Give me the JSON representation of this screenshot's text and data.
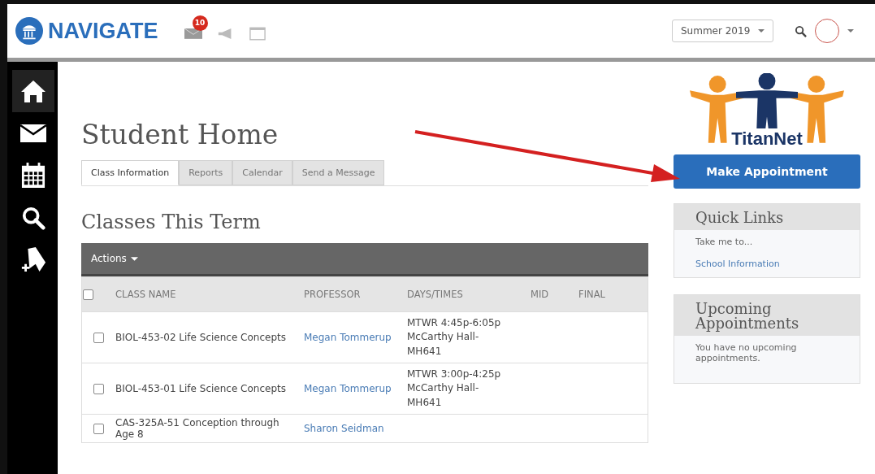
{
  "header": {
    "logo": "NAVIGATE",
    "message_badge": "10",
    "term_select": {
      "value": "Summer 2019"
    }
  },
  "sidebar": [
    {
      "kind": "home",
      "selected": true
    },
    {
      "kind": "mail",
      "selected": false
    },
    {
      "kind": "calendar",
      "selected": false
    },
    {
      "kind": "search",
      "selected": false
    },
    {
      "kind": "bookmark",
      "selected": false
    }
  ],
  "page_title": "Student Home",
  "tabs": [
    {
      "label": "Class Information",
      "selected": true
    },
    {
      "label": "Reports",
      "selected": false
    },
    {
      "label": "Calendar",
      "selected": false
    },
    {
      "label": "Send a Message",
      "selected": false
    }
  ],
  "section_title": "Classes This Term",
  "actions_label": "Actions",
  "table": {
    "select_all_checked": false,
    "columns": [
      "CLASS NAME",
      "PROFESSOR",
      "DAYS/TIMES",
      "MID",
      "FINAL"
    ],
    "rows": [
      {
        "checked": false,
        "class_name": "BIOL-453-02 Life Science Concepts",
        "professor": "Megan Tommerup",
        "days_times": [
          "MTWR 4:45p-6:05p",
          "McCarthy Hall-",
          "MH641"
        ]
      },
      {
        "checked": false,
        "class_name": "BIOL-453-01 Life Science Concepts",
        "professor": "Megan Tommerup",
        "days_times": [
          "MTWR 3:00p-4:25p",
          "McCarthy Hall-",
          "MH641"
        ]
      },
      {
        "checked": false,
        "class_name": "CAS-325A-51 Conception through Age 8",
        "professor": "Sharon Seidman",
        "days_times": []
      }
    ]
  },
  "logo_text": "TitanNet",
  "make_appointment": "Make Appointment",
  "quick_links": {
    "title": "Quick Links",
    "intro": "Take me to...",
    "links": [
      "School Information"
    ]
  },
  "upcoming": {
    "title": "Upcoming Appointments",
    "message": "You have no upcoming appointments."
  }
}
